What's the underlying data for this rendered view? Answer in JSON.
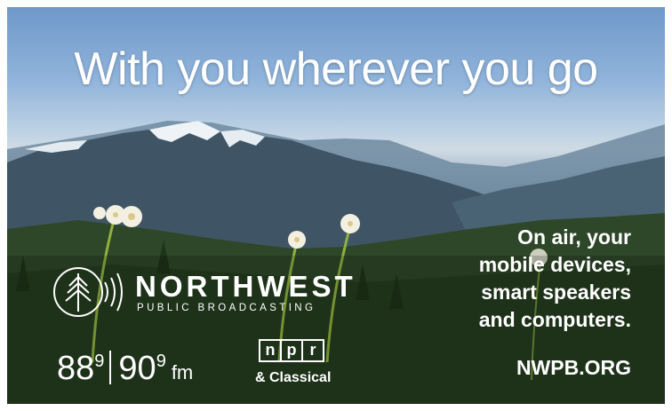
{
  "headline": "With you wherever you go",
  "brand": {
    "name": "NORTHWEST",
    "subtitle": "PUBLIC BROADCASTING",
    "logo": "tree-signal-icon"
  },
  "frequencies": {
    "first": "88",
    "first_decimal": "9",
    "second": "90",
    "second_decimal": "9",
    "unit": "fm"
  },
  "npr": {
    "letters": [
      "n",
      "p",
      "r"
    ],
    "classical": "& Classical"
  },
  "platforms": [
    "On air, your",
    "mobile devices,",
    "smart speakers",
    "and computers."
  ],
  "url": "NWPB.ORG",
  "colors": {
    "sky": "#8fb3da",
    "forest": "#2c4226",
    "text": "#ffffff"
  }
}
